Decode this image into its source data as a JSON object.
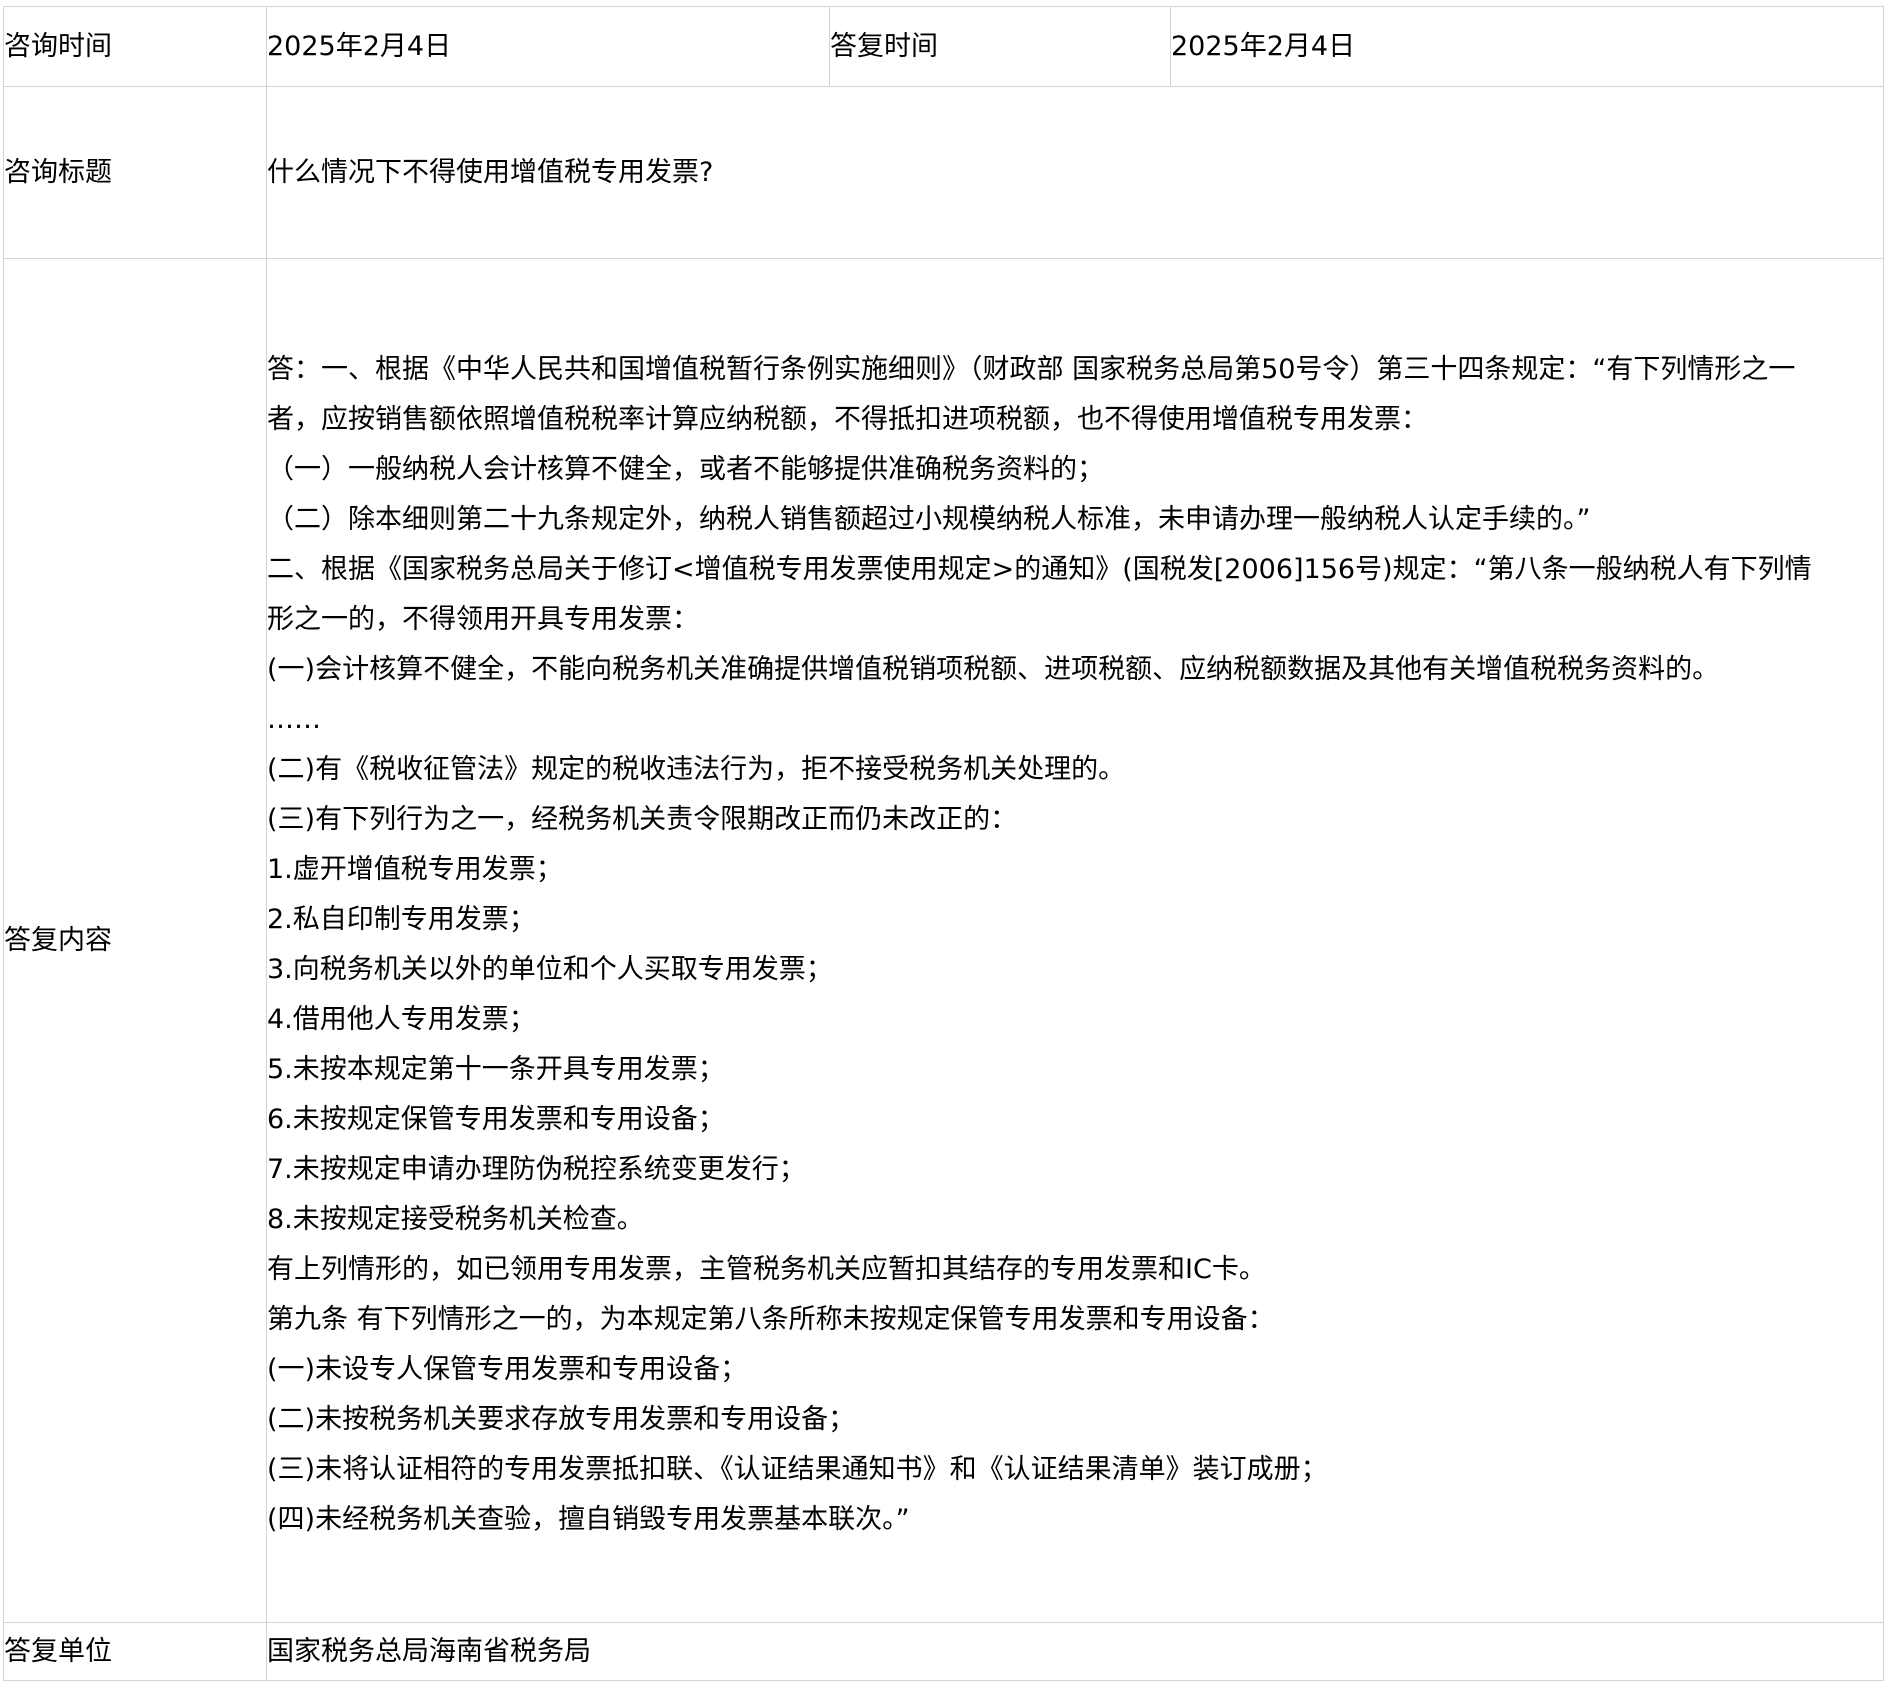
{
  "consult_time_label": "咨询时间",
  "consult_time_value": "2025年2月4日",
  "reply_time_label": "答复时间",
  "reply_time_value": "2025年2月4日",
  "title_label": "咨询标题",
  "title_value": "什么情况下不得使用增值税专用发票?",
  "content_label": "答复内容",
  "content_lines": [
    "答：一、根据《中华人民共和国增值税暂行条例实施细则》（财政部 国家税务总局第50号令）第三十四条规定：“有下列情形之一",
    "者，应按销售额依照增值税税率计算应纳税额，不得抵扣进项税额，也不得使用增值税专用发票：",
    "（一）一般纳税人会计核算不健全，或者不能够提供准确税务资料的；",
    "（二）除本细则第二十九条规定外，纳税人销售额超过小规模纳税人标准，未申请办理一般纳税人认定手续的。”",
    "二、根据《国家税务总局关于修订<增值税专用发票使用规定>的通知》(国税发[2006]156号)规定：“第八条一般纳税人有下列情",
    "形之一的，不得领用开具专用发票：",
    "(一)会计核算不健全，不能向税务机关准确提供增值税销项税额、进项税额、应纳税额数据及其他有关增值税税务资料的。",
    "……",
    "(二)有《税收征管法》规定的税收违法行为，拒不接受税务机关处理的。",
    "(三)有下列行为之一，经税务机关责令限期改正而仍未改正的：",
    "1.虚开增值税专用发票；",
    "2.私自印制专用发票；",
    "3.向税务机关以外的单位和个人买取专用发票；",
    "4.借用他人专用发票；",
    "5.未按本规定第十一条开具专用发票；",
    "6.未按规定保管专用发票和专用设备；",
    "7.未按规定申请办理防伪税控系统变更发行；",
    "8.未按规定接受税务机关检查。",
    "有上列情形的，如已领用专用发票，主管税务机关应暂扣其结存的专用发票和IC卡。",
    "第九条 有下列情形之一的，为本规定第八条所称未按规定保管专用发票和专用设备：",
    "(一)未设专人保管专用发票和专用设备；",
    "(二)未按税务机关要求存放专用发票和专用设备；",
    "(三)未将认证相符的专用发票抵扣联、《认证结果通知书》和《认证结果清单》装订成册；",
    "(四)未经税务机关查验，擅自销毁专用发票基本联次。”"
  ],
  "unit_label": "答复单位",
  "unit_value": "国家税务总局海南省税务局"
}
